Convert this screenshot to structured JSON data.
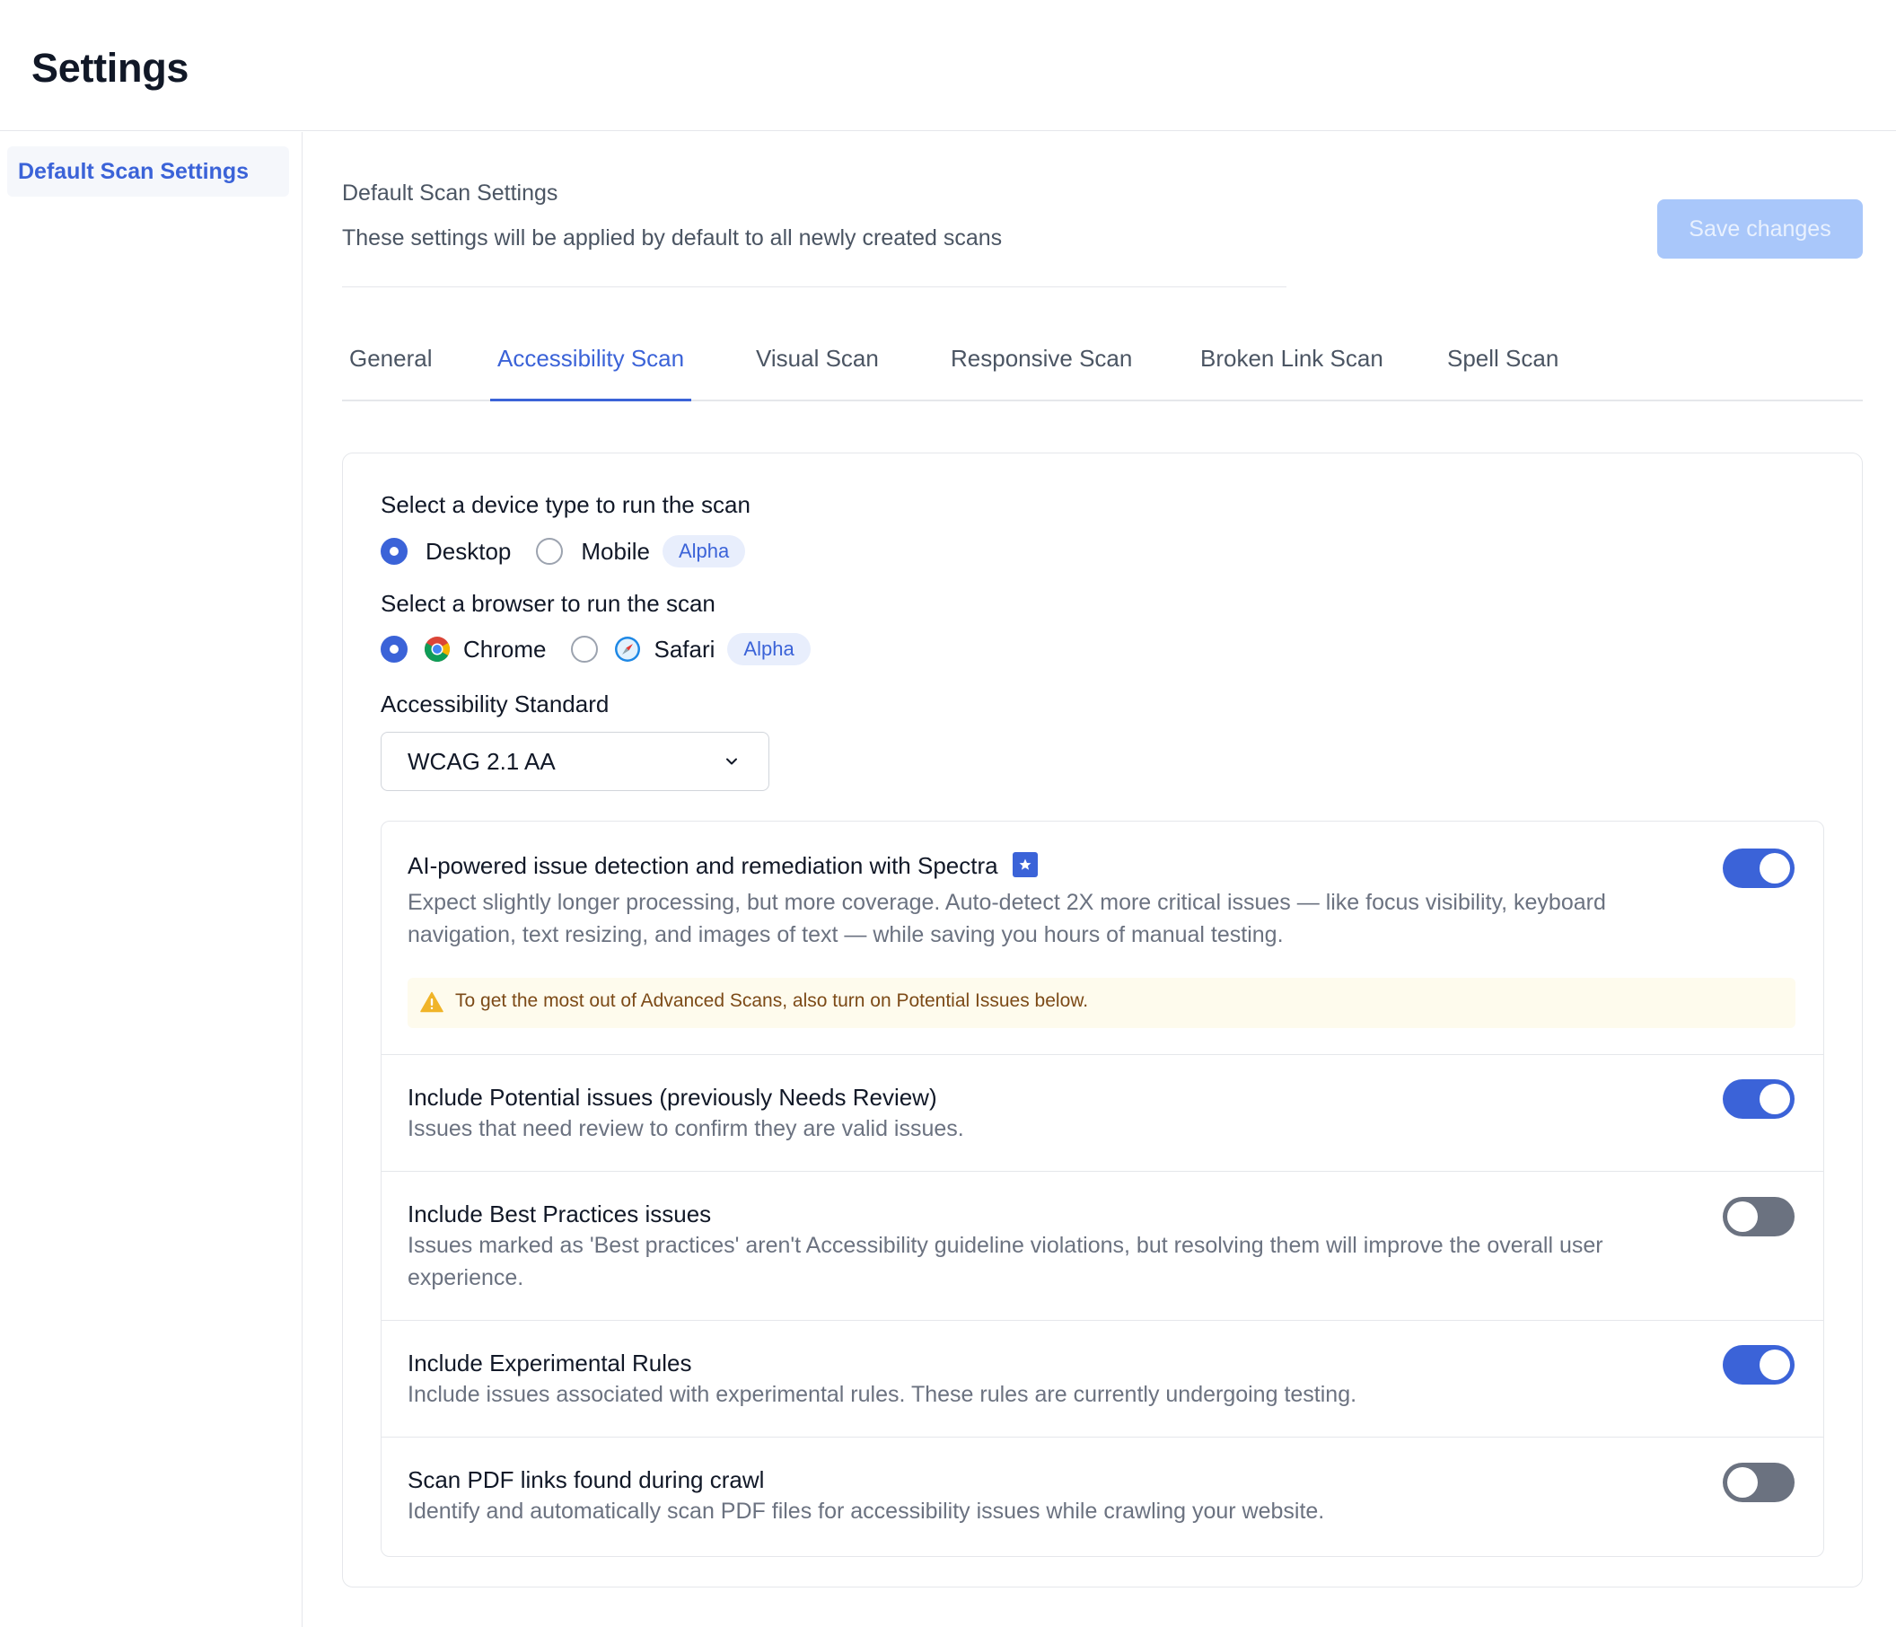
{
  "header": {
    "title": "Settings"
  },
  "sidebar": {
    "items": [
      {
        "label": "Default Scan Settings"
      }
    ]
  },
  "main": {
    "section_title": "Default Scan Settings",
    "section_desc": "These settings will be applied by default to all newly created scans",
    "save_label": "Save changes",
    "tabs": [
      {
        "label": "General",
        "active": false
      },
      {
        "label": "Accessibility Scan",
        "active": true
      },
      {
        "label": "Visual Scan",
        "active": false
      },
      {
        "label": "Responsive Scan",
        "active": false
      },
      {
        "label": "Broken Link Scan",
        "active": false
      },
      {
        "label": "Spell Scan",
        "active": false
      }
    ]
  },
  "form": {
    "device_label": "Select a device type to run the scan",
    "device_options": [
      {
        "label": "Desktop",
        "checked": true
      },
      {
        "label": "Mobile",
        "checked": false
      }
    ],
    "mobile_badge": "Alpha",
    "browser_label": "Select a browser to run the scan",
    "browser_options": [
      {
        "label": "Chrome",
        "checked": true,
        "icon": "chrome-icon"
      },
      {
        "label": "Safari",
        "checked": false,
        "icon": "safari-icon"
      }
    ],
    "safari_badge": "Alpha",
    "standard_label": "Accessibility Standard",
    "standard_value": "WCAG 2.1 AA",
    "options": [
      {
        "title": "AI-powered issue detection and remediation with Spectra",
        "desc": "Expect slightly longer processing, but more coverage. Auto-detect 2X more critical issues — like focus visibility, keyboard navigation, text resizing, and images of text — while saving you hours of manual testing.",
        "enabled": true,
        "warning": "To get the most out of Advanced Scans, also turn on Potential Issues below."
      },
      {
        "title": "Include Potential issues (previously Needs Review)",
        "desc": "Issues that need review to confirm they are valid issues.",
        "enabled": true
      },
      {
        "title": "Include Best Practices issues",
        "desc": "Issues marked as 'Best practices' aren't Accessibility guideline violations, but resolving them will improve the overall user experience.",
        "enabled": false
      },
      {
        "title": "Include Experimental Rules",
        "desc": "Include issues associated with experimental rules. These rules are currently undergoing testing.",
        "enabled": true
      },
      {
        "title": "Scan PDF links found during crawl",
        "desc": "Identify and automatically scan PDF files for accessibility issues while crawling your website.",
        "enabled": false
      }
    ]
  },
  "colors": {
    "accent": "#3b63d8",
    "save_button_disabled": "#a9c7fa",
    "toggle_off": "#6b7280",
    "warning_bg": "#fefbed",
    "warning_icon": "#f0b429"
  }
}
